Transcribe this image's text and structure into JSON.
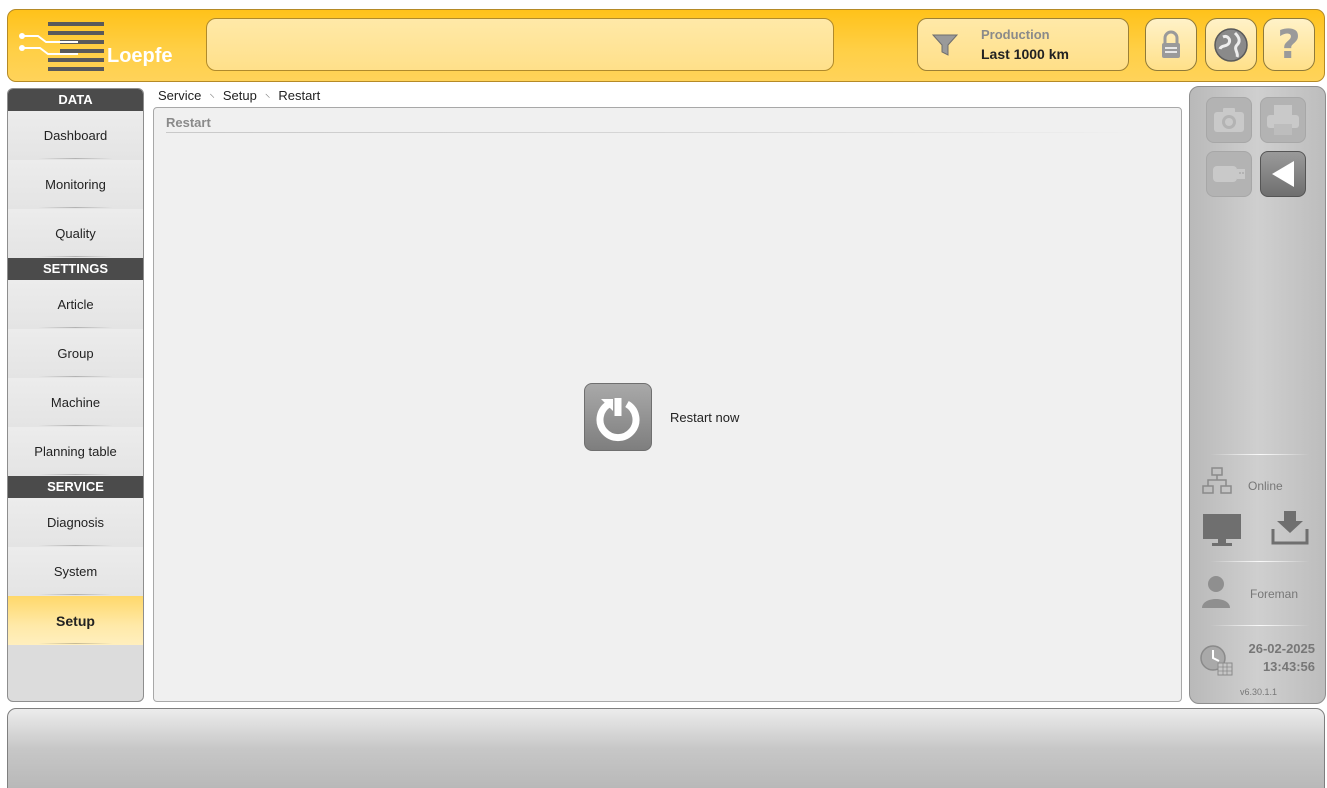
{
  "header": {
    "logo_text": "Loepfe",
    "production_title": "Production",
    "production_range": "Last 1000 km"
  },
  "nav": {
    "sections": [
      {
        "title": "DATA",
        "items": [
          "Dashboard",
          "Monitoring",
          "Quality"
        ]
      },
      {
        "title": "SETTINGS",
        "items": [
          "Article",
          "Group",
          "Machine",
          "Planning table"
        ]
      },
      {
        "title": "SERVICE",
        "items": [
          "Diagnosis",
          "System",
          "Setup"
        ]
      }
    ],
    "active": "Setup"
  },
  "breadcrumb": [
    "Service",
    "Setup",
    "Restart"
  ],
  "main": {
    "title": "Restart",
    "restart_label": "Restart now"
  },
  "right_panel": {
    "connection_status": "Online",
    "user_role": "Foreman",
    "date": "26-02-2025",
    "time": "13:43:56",
    "version": "v6.30.1.1"
  },
  "colors": {
    "header_yellow": "#ffc21a",
    "active_nav": "#ffe08a",
    "section_bg": "#4b4b4b"
  }
}
